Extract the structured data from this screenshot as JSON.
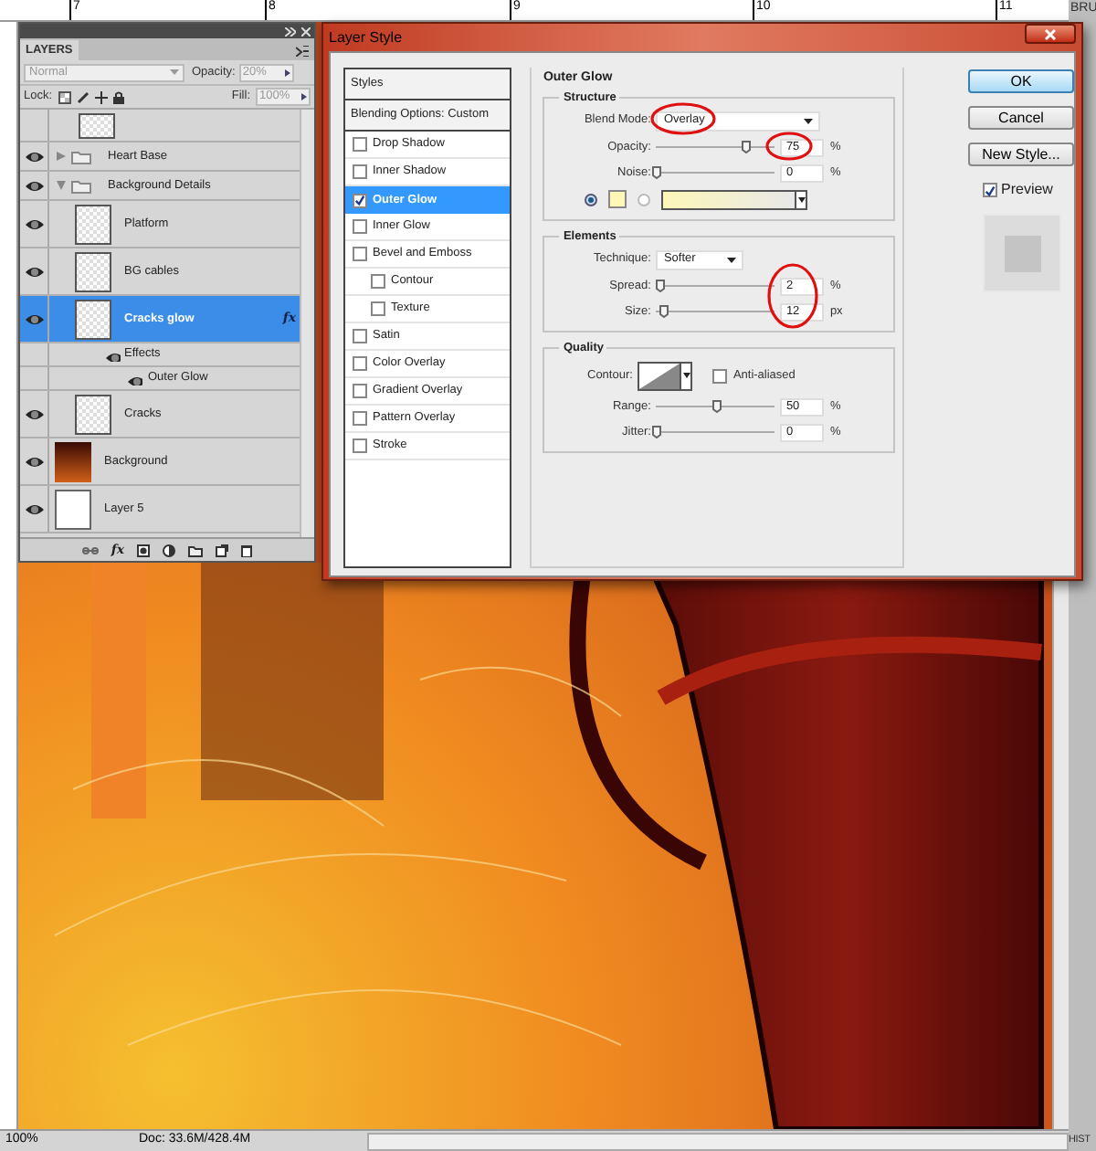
{
  "rulers": {
    "top_marks": [
      "7",
      "8",
      "9",
      "10",
      "11"
    ]
  },
  "right_panels": [
    "BRU",
    "HIST"
  ],
  "layers_panel": {
    "title": "LAYERS",
    "blend_mode": "Normal",
    "opacity_label": "Opacity:",
    "opacity": "20%",
    "lock_label": "Lock:",
    "fill_label": "Fill:",
    "fill": "100%",
    "layers": [
      {
        "kind": "transparent_layer",
        "visible": false,
        "selected": false
      },
      {
        "kind": "group",
        "name": "Heart Base",
        "visible": true,
        "selected": false,
        "expanded": false
      },
      {
        "kind": "group",
        "name": "Background Details",
        "visible": true,
        "selected": false,
        "expanded": true,
        "children": [
          {
            "kind": "transparent_layer",
            "name": "Platform",
            "visible": true,
            "selected": false
          },
          {
            "kind": "transparent_layer",
            "name": "BG cables",
            "visible": true,
            "selected": false
          },
          {
            "kind": "transparent_layer",
            "name": "Cracks glow",
            "visible": true,
            "selected": true,
            "fx": "fx",
            "effects": {
              "label": "Effects",
              "items": [
                "Outer Glow"
              ]
            }
          },
          {
            "kind": "transparent_layer",
            "name": "Cracks",
            "visible": true,
            "selected": false
          }
        ]
      },
      {
        "kind": "image_layer",
        "name": "Background",
        "visible": true,
        "selected": false
      },
      {
        "kind": "blank_layer",
        "name": "Layer 5",
        "visible": true,
        "selected": false
      }
    ],
    "toolbar_fx": "fx"
  },
  "dialog": {
    "title": "Layer Style",
    "styles": [
      {
        "kind": "header",
        "label": "Styles",
        "selected": false
      },
      {
        "kind": "header",
        "label": "Blending Options: Custom",
        "selected": false
      },
      {
        "kind": "check",
        "label": "Drop Shadow",
        "checked": false,
        "selected": false
      },
      {
        "kind": "check",
        "label": "Inner Shadow",
        "checked": false,
        "selected": false
      },
      {
        "kind": "check",
        "label": "Outer Glow",
        "checked": true,
        "selected": true
      },
      {
        "kind": "check",
        "label": "Inner Glow",
        "checked": false,
        "selected": false
      },
      {
        "kind": "check",
        "label": "Bevel and Emboss",
        "checked": false,
        "selected": false,
        "children": [
          {
            "kind": "check",
            "label": "Contour",
            "checked": false,
            "selected": false
          },
          {
            "kind": "check",
            "label": "Texture",
            "checked": false,
            "selected": false
          }
        ]
      },
      {
        "kind": "check",
        "label": "Satin",
        "checked": false,
        "selected": false
      },
      {
        "kind": "check",
        "label": "Color Overlay",
        "checked": false,
        "selected": false
      },
      {
        "kind": "check",
        "label": "Gradient Overlay",
        "checked": false,
        "selected": false
      },
      {
        "kind": "check",
        "label": "Pattern Overlay",
        "checked": false,
        "selected": false
      },
      {
        "kind": "check",
        "label": "Stroke",
        "checked": false,
        "selected": false
      }
    ],
    "section_title": "Outer Glow",
    "structure": {
      "title": "Structure",
      "blend_label": "Blend Mode:",
      "blend_mode": "Overlay",
      "sliders": [
        {
          "label": "Opacity:",
          "level": 0.75,
          "value": "75",
          "unit": "%"
        },
        {
          "label": "Noise:",
          "level": 0,
          "value": "0",
          "unit": "%"
        }
      ],
      "color_modes": [
        {
          "kind": "solid",
          "selected": true,
          "color": "#fdf7b8"
        },
        {
          "kind": "gradient",
          "selected": false,
          "color": "#fdf7b8"
        }
      ]
    },
    "elements": {
      "title": "Elements",
      "technique_label": "Technique:",
      "technique": "Softer",
      "sliders": [
        {
          "label": "Spread:",
          "level": 0.02,
          "value": "2",
          "unit": "%"
        },
        {
          "label": "Size:",
          "level": 0.05,
          "value": "12",
          "unit": "px"
        }
      ]
    },
    "quality": {
      "title": "Quality",
      "contour_label": "Contour:",
      "anti_aliased": {
        "label": "Anti-aliased",
        "checked": false
      },
      "sliders": [
        {
          "label": "Range:",
          "level": 0.5,
          "value": "50",
          "unit": "%"
        },
        {
          "label": "Jitter:",
          "level": 0,
          "value": "0",
          "unit": "%"
        }
      ]
    },
    "buttons": [
      {
        "label": "OK",
        "default": true
      },
      {
        "label": "Cancel",
        "default": false
      },
      {
        "label": "New Style...",
        "default": false
      }
    ],
    "preview": {
      "label": "Preview",
      "checked": true
    }
  },
  "status_bar": {
    "zoom": "100%",
    "doc": "Doc: 33.6M/428.4M"
  }
}
